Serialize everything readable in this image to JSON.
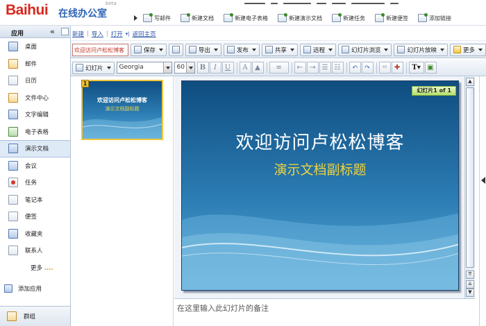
{
  "app": {
    "logo_latin": "Baihui",
    "logo_cn": "在线办公室",
    "beta": "beta"
  },
  "quick_actions": [
    {
      "label": "写邮件",
      "icon": "compose-mail-icon"
    },
    {
      "label": "新建文档",
      "icon": "new-document-icon"
    },
    {
      "label": "新建电子表格",
      "icon": "new-spreadsheet-icon"
    },
    {
      "label": "新建演示文档",
      "icon": "new-presentation-icon"
    },
    {
      "label": "新建任务",
      "icon": "new-task-icon"
    },
    {
      "label": "新建便签",
      "icon": "new-note-icon"
    },
    {
      "label": "添加链接",
      "icon": "add-link-icon"
    }
  ],
  "sidebar": {
    "header": "应用",
    "collapse": "«",
    "items": [
      {
        "label": "桌面",
        "icon": "desktop-icon"
      },
      {
        "label": "邮件",
        "icon": "mail-icon"
      },
      {
        "label": "日历",
        "icon": "calendar-icon"
      },
      {
        "label": "文件中心",
        "icon": "folder-icon"
      },
      {
        "label": "文字编辑",
        "icon": "writer-icon"
      },
      {
        "label": "电子表格",
        "icon": "spreadsheet-icon"
      },
      {
        "label": "演示文档",
        "icon": "presentation-icon"
      },
      {
        "label": "会议",
        "icon": "meeting-icon"
      },
      {
        "label": "任务",
        "icon": "task-icon"
      },
      {
        "label": "笔记本",
        "icon": "notebook-icon"
      },
      {
        "label": "便签",
        "icon": "sticky-note-icon"
      },
      {
        "label": "收藏夹",
        "icon": "favorites-icon"
      },
      {
        "label": "联系人",
        "icon": "contacts-icon"
      }
    ],
    "more": "更多",
    "more_dots": "....",
    "add_app": "添加应用",
    "group": "群组"
  },
  "menubar": {
    "new": "新建",
    "import": "导入",
    "open": "打开",
    "back_home": "返回主页"
  },
  "toolbar1": {
    "title_value": "欢迎访问卢松松博客",
    "save": "保存",
    "export": "导出",
    "publish": "发布",
    "share": "共享",
    "remote": "远程",
    "slide_browse": "幻灯片浏览",
    "slide_show": "幻灯片放映",
    "more": "更多"
  },
  "toolbar2": {
    "slide": "幻灯片",
    "font": "Georgia",
    "size": "60",
    "bold": "B",
    "italic": "I",
    "underline": "U"
  },
  "slide": {
    "number": "1",
    "badge": "幻灯片1 of 1",
    "title": "欢迎访问卢松松博客",
    "subtitle": "演示文档副标题"
  },
  "notes": {
    "placeholder": "在这里输入此幻灯片的备注"
  },
  "colors": {
    "brand_blue": "#2f64b5",
    "brand_red": "#d8281e",
    "slide_bg": "#1d5d93",
    "subtitle": "#f0d43b"
  }
}
